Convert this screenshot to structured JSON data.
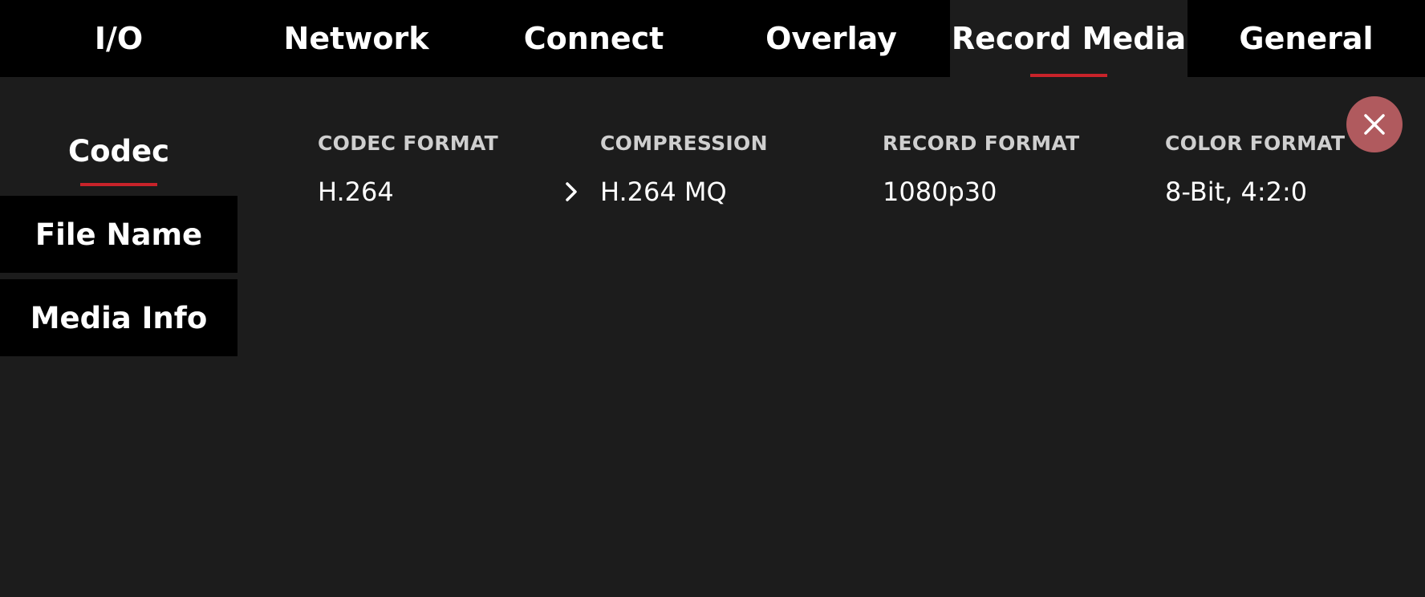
{
  "tabs": [
    {
      "label": "I/O",
      "active": false
    },
    {
      "label": "Network",
      "active": false
    },
    {
      "label": "Connect",
      "active": false
    },
    {
      "label": "Overlay",
      "active": false
    },
    {
      "label": "Record Media",
      "active": true
    },
    {
      "label": "General",
      "active": false
    }
  ],
  "sidebar": {
    "items": [
      {
        "label": "Codec",
        "active": true
      },
      {
        "label": "File Name",
        "active": false
      },
      {
        "label": "Media Info",
        "active": false
      }
    ]
  },
  "fields": [
    {
      "label": "CODEC FORMAT",
      "value": "H.264"
    },
    {
      "label": "COMPRESSION",
      "value": "H.264 MQ"
    },
    {
      "label": "RECORD FORMAT",
      "value": "1080p30"
    },
    {
      "label": "COLOR FORMAT",
      "value": "8-Bit, 4:2:0"
    }
  ],
  "icons": {
    "close": "close-icon",
    "chevron": "chevron-right-icon"
  },
  "colors": {
    "accent": "#c8232a",
    "close_button": "#b05a5e",
    "background": "#1c1c1c",
    "bar": "#000000"
  }
}
